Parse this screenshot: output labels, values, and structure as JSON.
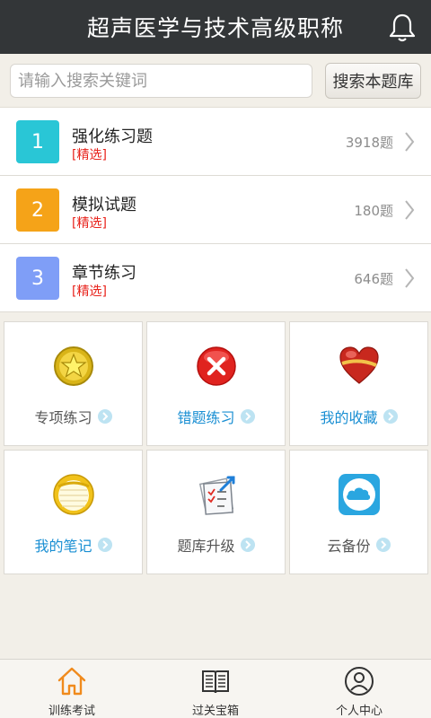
{
  "header": {
    "title": "超声医学与技术高级职称"
  },
  "search": {
    "placeholder": "请输入搜索关键词",
    "value": "",
    "button_label": "搜索本题库"
  },
  "practice_list": [
    {
      "num": "1",
      "name": "强化练习题",
      "tag": "[精选]",
      "count": "3918题",
      "color": "#29c6d6"
    },
    {
      "num": "2",
      "name": "模拟试题",
      "tag": "[精选]",
      "count": "180题",
      "color": "#f5a318"
    },
    {
      "num": "3",
      "name": "章节练习",
      "tag": "[精选]",
      "count": "646题",
      "color": "#7f9ef7"
    }
  ],
  "tiles": [
    {
      "label": "专项练习",
      "icon": "star-medal-icon",
      "label_color": "#555555"
    },
    {
      "label": "错题练习",
      "icon": "error-x-icon",
      "label_color": "#1a8fd3"
    },
    {
      "label": "我的收藏",
      "icon": "heart-icon",
      "label_color": "#1a8fd3"
    },
    {
      "label": "我的笔记",
      "icon": "notepad-icon",
      "label_color": "#1a8fd3"
    },
    {
      "label": "题库升级",
      "icon": "upgrade-checklist-icon",
      "label_color": "#555555"
    },
    {
      "label": "云备份",
      "icon": "cloud-icon",
      "label_color": "#555555"
    }
  ],
  "tabbar": [
    {
      "label": "训练考试",
      "icon": "home-icon",
      "active": true
    },
    {
      "label": "过关宝箱",
      "icon": "book-icon",
      "active": false
    },
    {
      "label": "个人中心",
      "icon": "user-icon",
      "active": false
    }
  ],
  "colors": {
    "header_bg": "#333638",
    "accent_orange": "#f08a1c",
    "tag_red": "#e8221b",
    "link_blue": "#1a8fd3"
  }
}
